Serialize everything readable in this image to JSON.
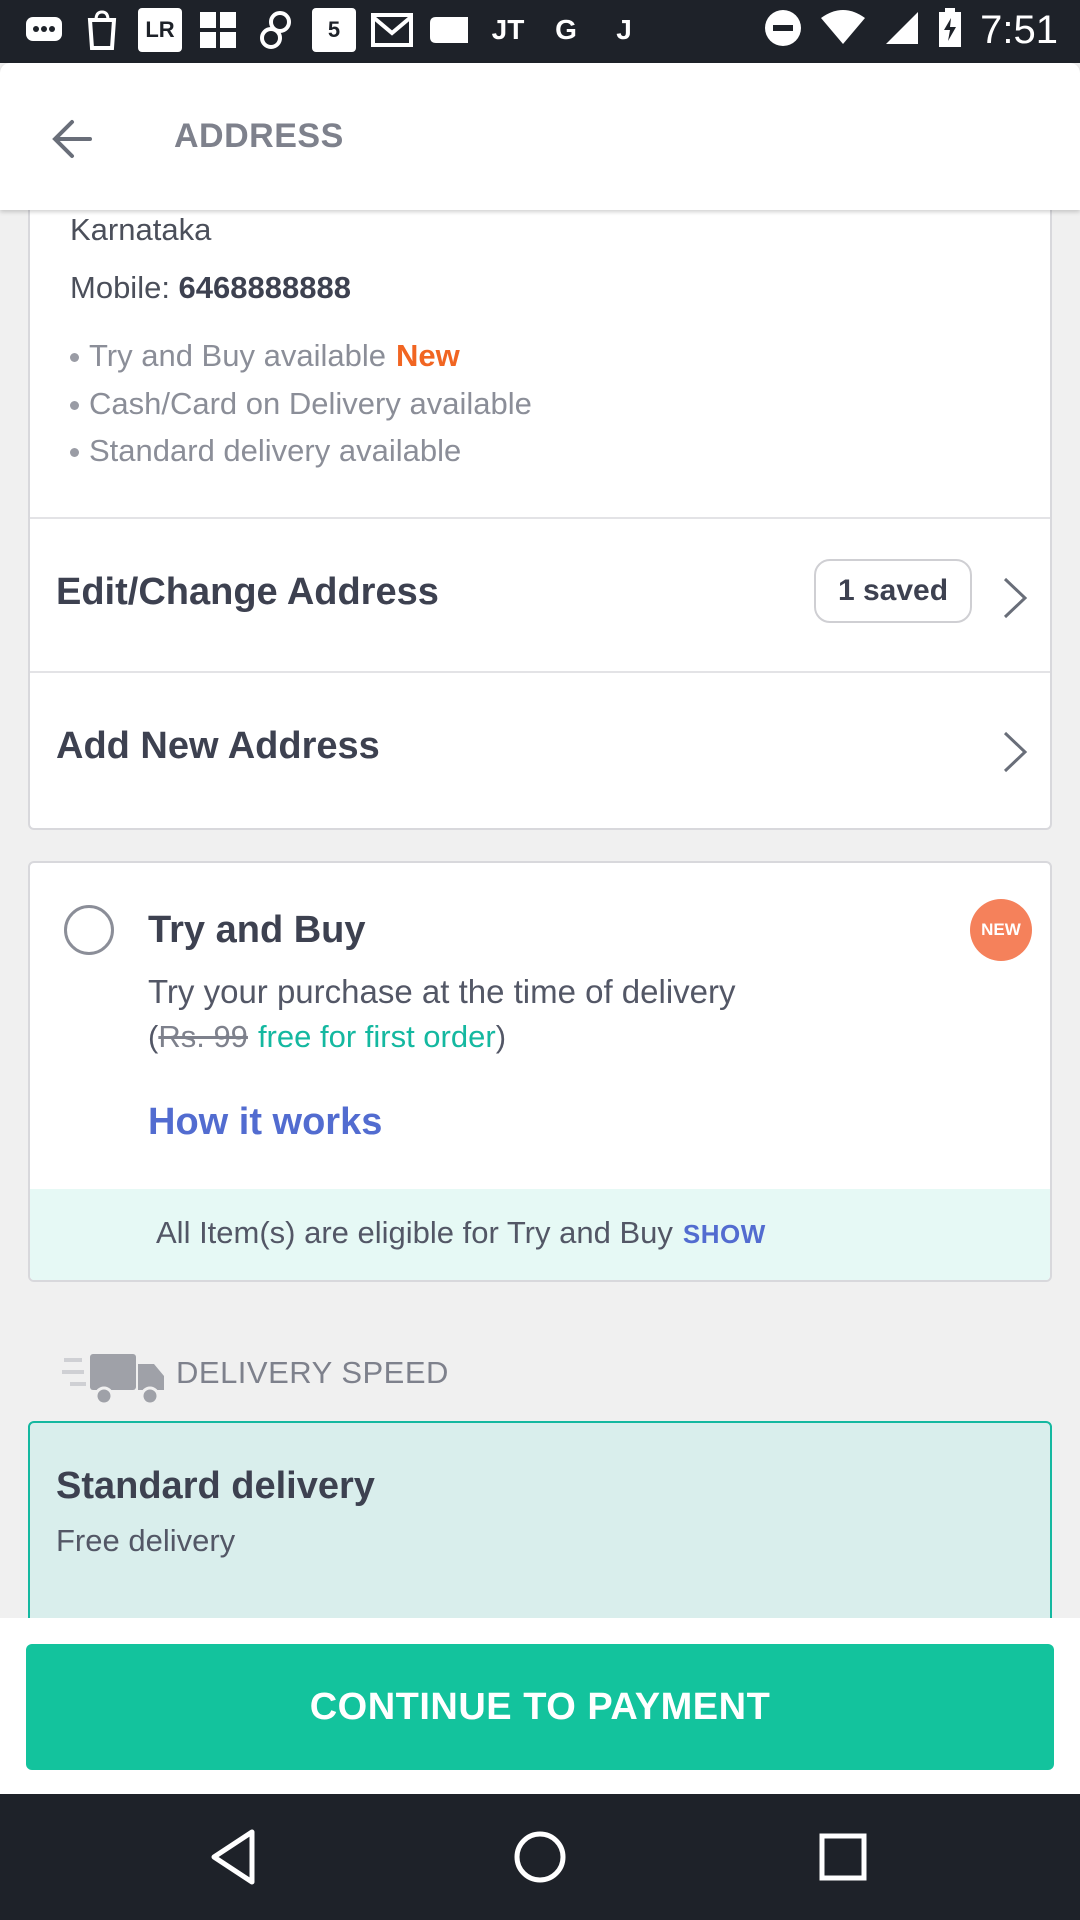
{
  "status_bar": {
    "time": "7:51",
    "left_icons": [
      "message-icon",
      "shopping-icon",
      "lr-icon",
      "grid-icon",
      "link-icon",
      "five-icon",
      "gmail-icon",
      "tag-icon",
      "jt-icon",
      "google-icon",
      "j-icon"
    ],
    "lr_text": "LR",
    "five_text": "5",
    "jt_text": "JT",
    "g_text": "G",
    "j_text": "J"
  },
  "header": {
    "title": "ADDRESS"
  },
  "address": {
    "state": "Karnataka",
    "mobile_label": "Mobile: ",
    "mobile_number": "6468888888",
    "features": [
      {
        "text": "Try and Buy available",
        "tag": "New"
      },
      {
        "text": "Cash/Card on Delivery available"
      },
      {
        "text": "Standard delivery available"
      }
    ]
  },
  "edit_address": {
    "label": "Edit/Change Address",
    "saved_count": "1 saved"
  },
  "add_address": {
    "label": "Add New Address"
  },
  "try_and_buy": {
    "title": "Try and Buy",
    "badge": "NEW",
    "description": "Try your purchase at the time of delivery",
    "open_paren": "(",
    "old_price": "Rs. 99",
    "free_text": "free for first order",
    "close_paren": ")",
    "how_link": "How it works",
    "eligible_text": "All Item(s) are eligible for Try and Buy",
    "show_link": "SHOW"
  },
  "delivery_speed": {
    "title": "DELIVERY SPEED",
    "option_title": "Standard delivery",
    "option_subtitle": "Free delivery"
  },
  "cta": {
    "label": "CONTINUE TO PAYMENT"
  },
  "colors": {
    "accent": "#13c39d",
    "link": "#526cd0",
    "new_orange": "#f16522"
  }
}
